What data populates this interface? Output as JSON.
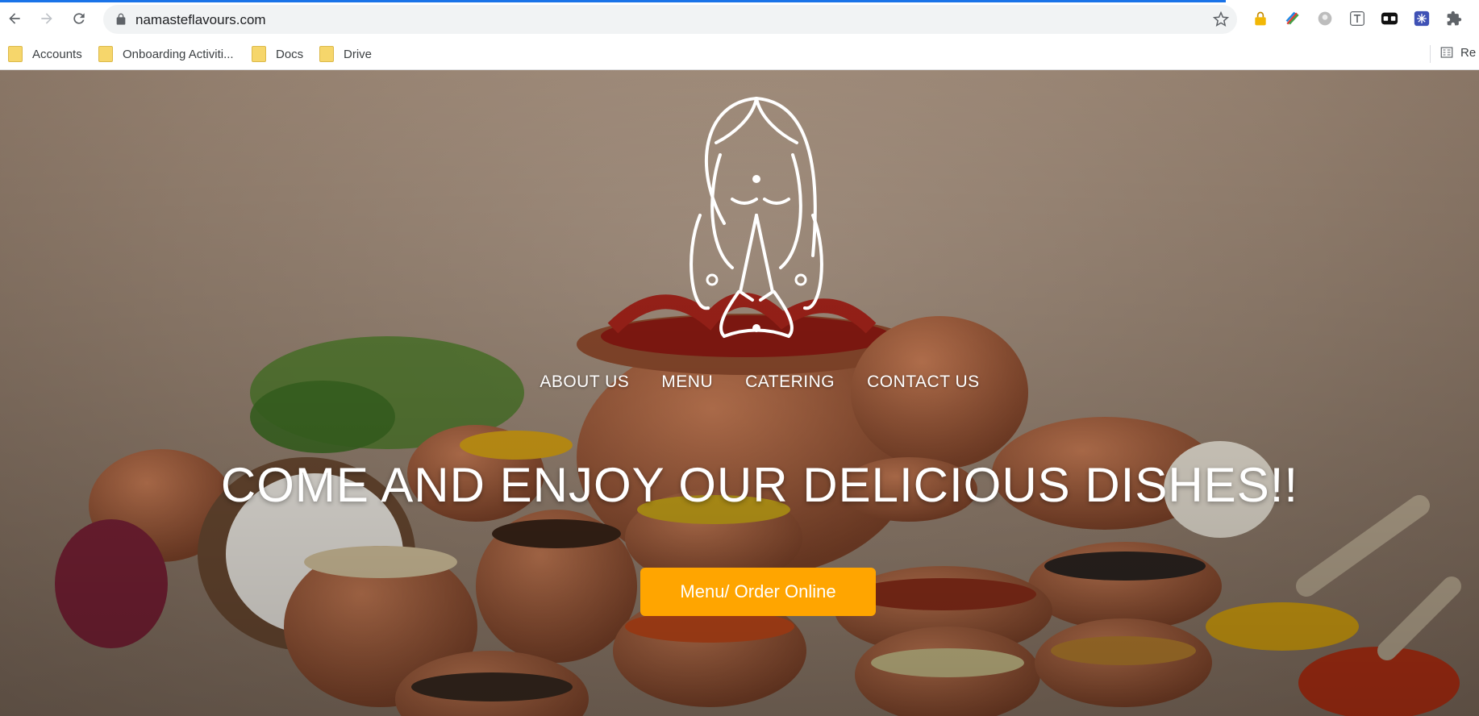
{
  "browser": {
    "url": "namasteflavours.com",
    "bookmarks": [
      {
        "label": "Accounts"
      },
      {
        "label": "Onboarding Activiti..."
      },
      {
        "label": "Docs"
      },
      {
        "label": "Drive"
      }
    ],
    "reading_list_label": "Re"
  },
  "site": {
    "nav": {
      "about": "ABOUT US",
      "menu": "MENU",
      "catering": "CATERING",
      "contact": "CONTACT US"
    },
    "headline": "COME AND ENJOY OUR DELICIOUS DISHES!!",
    "cta_label": "Menu/ Order Online",
    "accent_color": "#ffa500"
  }
}
